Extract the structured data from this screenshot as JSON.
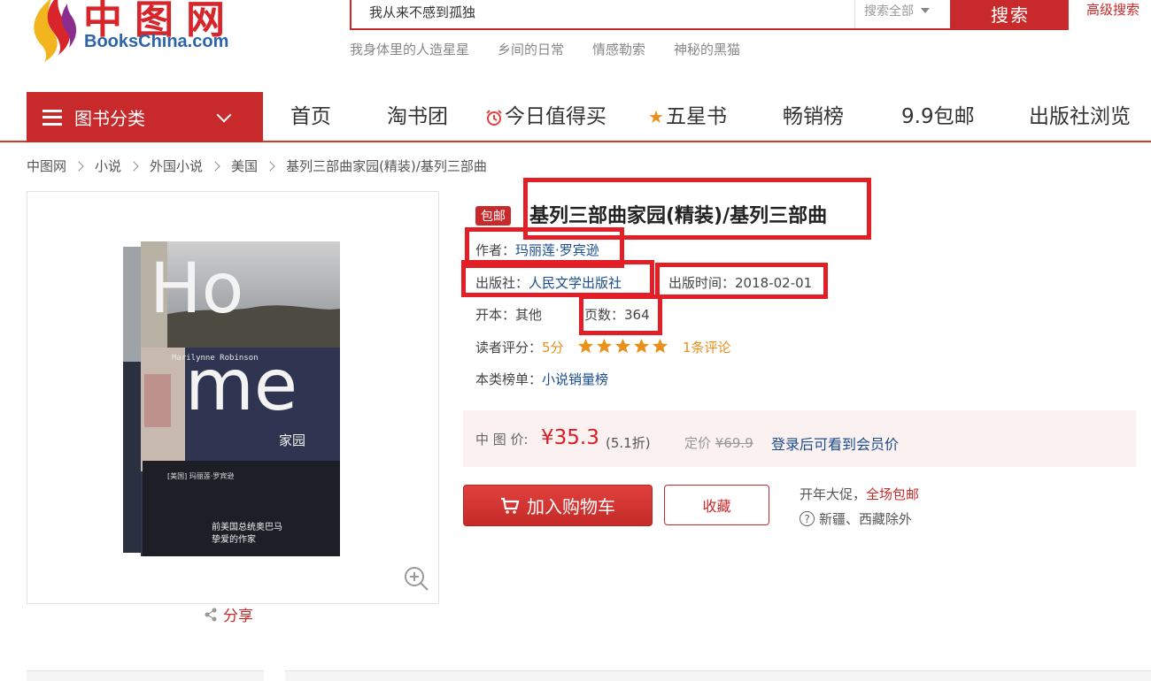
{
  "header": {
    "logo_cn": "中图网",
    "logo_en": "BooksChina.com",
    "search_value": "我从来不感到孤独",
    "search_scope": "搜索全部",
    "search_button": "搜索",
    "advanced_search": "高级搜索",
    "hot_words": [
      "我身体里的人造星星",
      "乡间的日常",
      "情感勒索",
      "神秘的黑猫"
    ]
  },
  "nav": {
    "category_menu": "图书分类",
    "items": [
      "首页",
      "淘书团",
      "今日值得买",
      "五星书",
      "畅销榜",
      "9.9包邮",
      "出版社浏览"
    ]
  },
  "breadcrumb": [
    "中图网",
    "小说",
    "外国小说",
    "美国",
    "基列三部曲家园(精装)/基列三部曲"
  ],
  "product": {
    "badge": "包邮",
    "title": "基列三部曲家园(精装)/基列三部曲",
    "author_label": "作者：",
    "author": "玛丽莲·罗宾逊",
    "publisher_label": "出版社：",
    "publisher": "人民文学出版社",
    "pub_date_label": "出版时间：",
    "pub_date": "2018-02-01",
    "format_label": "开本：",
    "format": "其他",
    "pages_label": "页数：",
    "pages": "364",
    "rating_label": "读者评分：",
    "rating": "5分",
    "rating_stars": 5,
    "reviews": "1条评论",
    "rank_label": "本类榜单：",
    "rank": "小说销量榜",
    "share": "分享"
  },
  "book_cover": {
    "title_en_1": "Ho",
    "title_en_2": "me",
    "author_en": "Marilynne Robinson",
    "title_cn": "家园",
    "author_cn": "[美国] 玛丽莲·罗宾逊",
    "tagline": "前美国总统奥巴马挚爱的作家"
  },
  "price": {
    "label": "中 图 价:",
    "value": "¥35.3",
    "discount": "(5.1折)",
    "list_label": "定价",
    "list_price": "¥69.9",
    "member_text": "登录后可看到会员价"
  },
  "actions": {
    "add_to_cart": "加入购物车",
    "favorite": "收藏",
    "promo_text": "开年大促，",
    "promo_highlight": "全场包邮",
    "exclude": "新疆、西藏除外"
  },
  "colors": {
    "brand_red": "#c8292b",
    "highlight_box": "#e21e26",
    "link_blue": "#1a4d8f",
    "rating_orange": "#e8901c"
  }
}
